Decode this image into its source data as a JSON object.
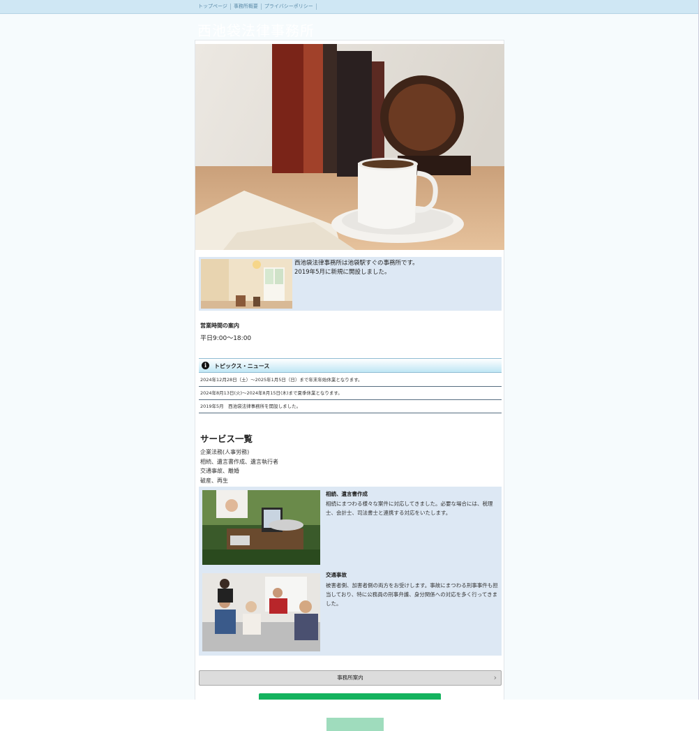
{
  "nav": {
    "items": [
      "トップページ",
      "事務所概要",
      "プライバシーポリシー"
    ]
  },
  "site": {
    "title": "西池袋法律事務所"
  },
  "intro": {
    "line1": "西池袋法律事務所は池袋駅すぐの事務所です。",
    "line2": "2019年5月に新規に開設しました。"
  },
  "hours": {
    "title": "営業時間の案内",
    "value": "平日9:00〜18:00"
  },
  "topics": {
    "heading": "トピックス・ニュース",
    "icon": "info-icon",
    "items": [
      "2024年12月28日（土）〜2025年1月5日（日）まで年末年始休業となります。",
      "2024年8月13日(火)〜2024年8月15日(木)まで夏季休業となります。",
      "2019年5月　西池袋法律事務所を開設しました。"
    ]
  },
  "services": {
    "title": "サービス一覧",
    "list": [
      "企業法務(人事労務)",
      "相続、遺言書作成、遺言執行者",
      "交通事故、離婚",
      "破産、再生"
    ],
    "cards": [
      {
        "heading": "相続、遺言書作成",
        "body": "相続にまつわる様々な案件に対応してきました。必要な場合には、税理士、会計士、司法書士と連携する対応をいたします。"
      },
      {
        "heading": "交通事故",
        "body": "被害者側、加害者側の両方をお受けします。事故にまつわる刑事事件も担当しており、特に公務員の刑事弁護、身分関係への対応を多く行ってきました。"
      }
    ]
  },
  "buttons": {
    "office": "事務所案内",
    "chevron": "›"
  },
  "colors": {
    "topbar": "#cfe7f4",
    "panel": "#dde8f4",
    "contact_button": "#14b35e"
  }
}
